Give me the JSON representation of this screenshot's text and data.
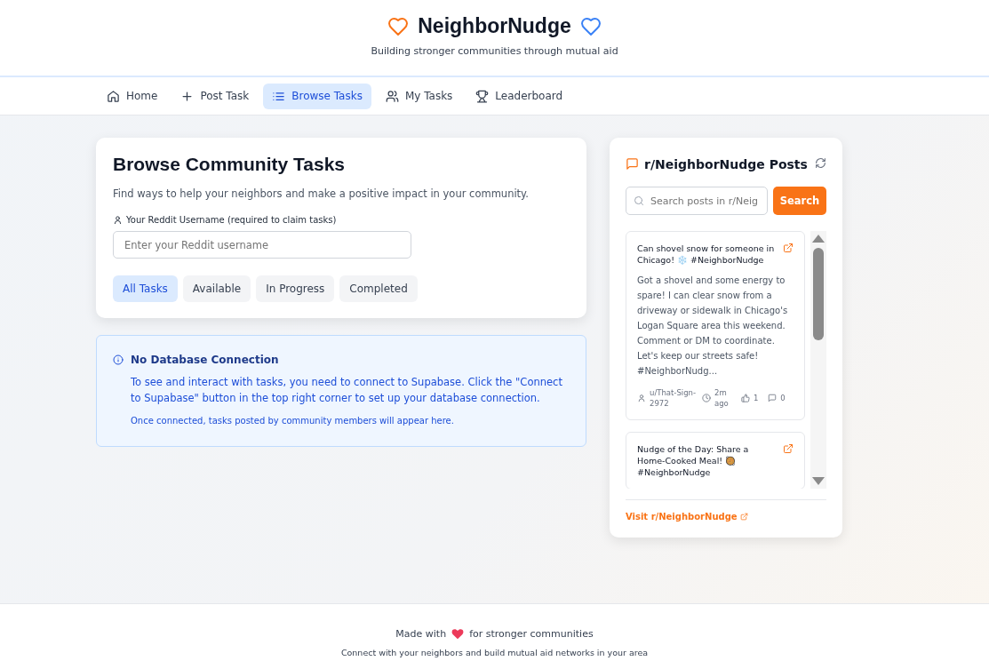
{
  "header": {
    "title": "NeighborNudge",
    "subtitle": "Building stronger communities through mutual aid"
  },
  "nav": [
    {
      "label": "Home",
      "selected": false
    },
    {
      "label": "Post Task",
      "selected": false
    },
    {
      "label": "Browse Tasks",
      "selected": true
    },
    {
      "label": "My Tasks",
      "selected": false
    },
    {
      "label": "Leaderboard",
      "selected": false
    }
  ],
  "browse": {
    "title": "Browse Community Tasks",
    "description": "Find ways to help your neighbors and make a positive impact in your community.",
    "username_label": "Your Reddit Username (required to claim tasks)",
    "username_placeholder": "Enter your Reddit username",
    "filters": [
      {
        "label": "All Tasks",
        "selected": true
      },
      {
        "label": "Available",
        "selected": false
      },
      {
        "label": "In Progress",
        "selected": false
      },
      {
        "label": "Completed",
        "selected": false
      }
    ]
  },
  "notice": {
    "title": "No Database Connection",
    "message": "To see and interact with tasks, you need to connect to Supabase. Click the \"Connect to Supabase\" button in the top right corner to set up your database connection.",
    "note": "Once connected, tasks posted by community members will appear here."
  },
  "reddit_panel": {
    "title": "r/NeighborNudge Posts",
    "search_placeholder": "Search posts in r/Neig",
    "search_button": "Search",
    "posts": [
      {
        "title": "Can shovel snow for someone in Chicago! ❄️ #NeighborNudge",
        "body": "Got a shovel and some energy to spare! I can clear snow from a driveway or sidewalk in Chicago's Logan Square area this weekend. Comment or DM to coordinate. Let's keep our streets safe! #NeighborNudg...",
        "author": "u/That-Sign-2972",
        "age": "2m ago",
        "upvotes": "1",
        "comments": "0"
      },
      {
        "title": "Nudge of the Day: Share a Home-Cooked Meal! 🥘 #NeighborNudge"
      }
    ],
    "visit_link": "Visit r/NeighborNudge"
  },
  "footer": {
    "made_with": "Made with",
    "made_for": "for stronger communities",
    "note": "Connect with your neighbors and build mutual aid networks in your area"
  }
}
